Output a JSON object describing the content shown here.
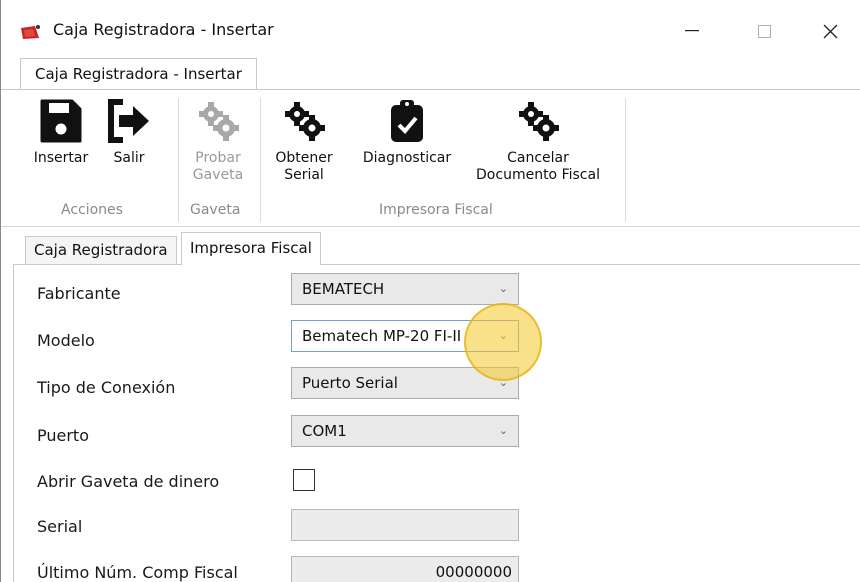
{
  "window": {
    "title": "Caja Registradora - Insertar",
    "controls": {
      "minimize": "—",
      "maximize": "☐",
      "close": "✕"
    }
  },
  "ribbon": {
    "tab_label": "Caja Registradora - Insertar",
    "groups": {
      "acciones": "Acciones",
      "gaveta": "Gaveta",
      "impresora": "Impresora Fiscal"
    },
    "buttons": {
      "insertar": {
        "line1": "Insertar",
        "icon": "save-icon"
      },
      "salir": {
        "line1": "Salir",
        "icon": "exit-icon"
      },
      "probar_gaveta": {
        "line1": "Probar",
        "line2": "Gaveta",
        "icon": "gears-icon",
        "enabled": false
      },
      "obtener_serial": {
        "line1": "Obtener",
        "line2": "Serial",
        "icon": "gears-icon"
      },
      "diagnosticar": {
        "line1": "Diagnosticar",
        "icon": "clipboard-check-icon"
      },
      "cancelar_doc": {
        "line1": "Cancelar",
        "line2": "Documento Fiscal",
        "icon": "gears-icon"
      }
    }
  },
  "form_tabs": [
    "Caja Registradora",
    "Impresora Fiscal"
  ],
  "active_tab": "Impresora Fiscal",
  "form": {
    "fabricante": {
      "label": "Fabricante",
      "value": "BEMATECH"
    },
    "modelo": {
      "label": "Modelo",
      "value": "Bematech MP-20 FI-II"
    },
    "tipo_conexion": {
      "label": "Tipo de Conexión",
      "value": "Puerto Serial"
    },
    "puerto": {
      "label": "Puerto",
      "value": "COM1"
    },
    "abrir_gaveta": {
      "label": "Abrir Gaveta de dinero",
      "checked": false
    },
    "serial": {
      "label": "Serial",
      "value": ""
    },
    "ultimo_num": {
      "label": "Último Núm. Comp Fiscal",
      "value": "00000000"
    }
  },
  "colors": {
    "accent_highlight": "#f3c828",
    "disabled_text": "#9a9a9a",
    "group_label": "#8a8a8a"
  }
}
